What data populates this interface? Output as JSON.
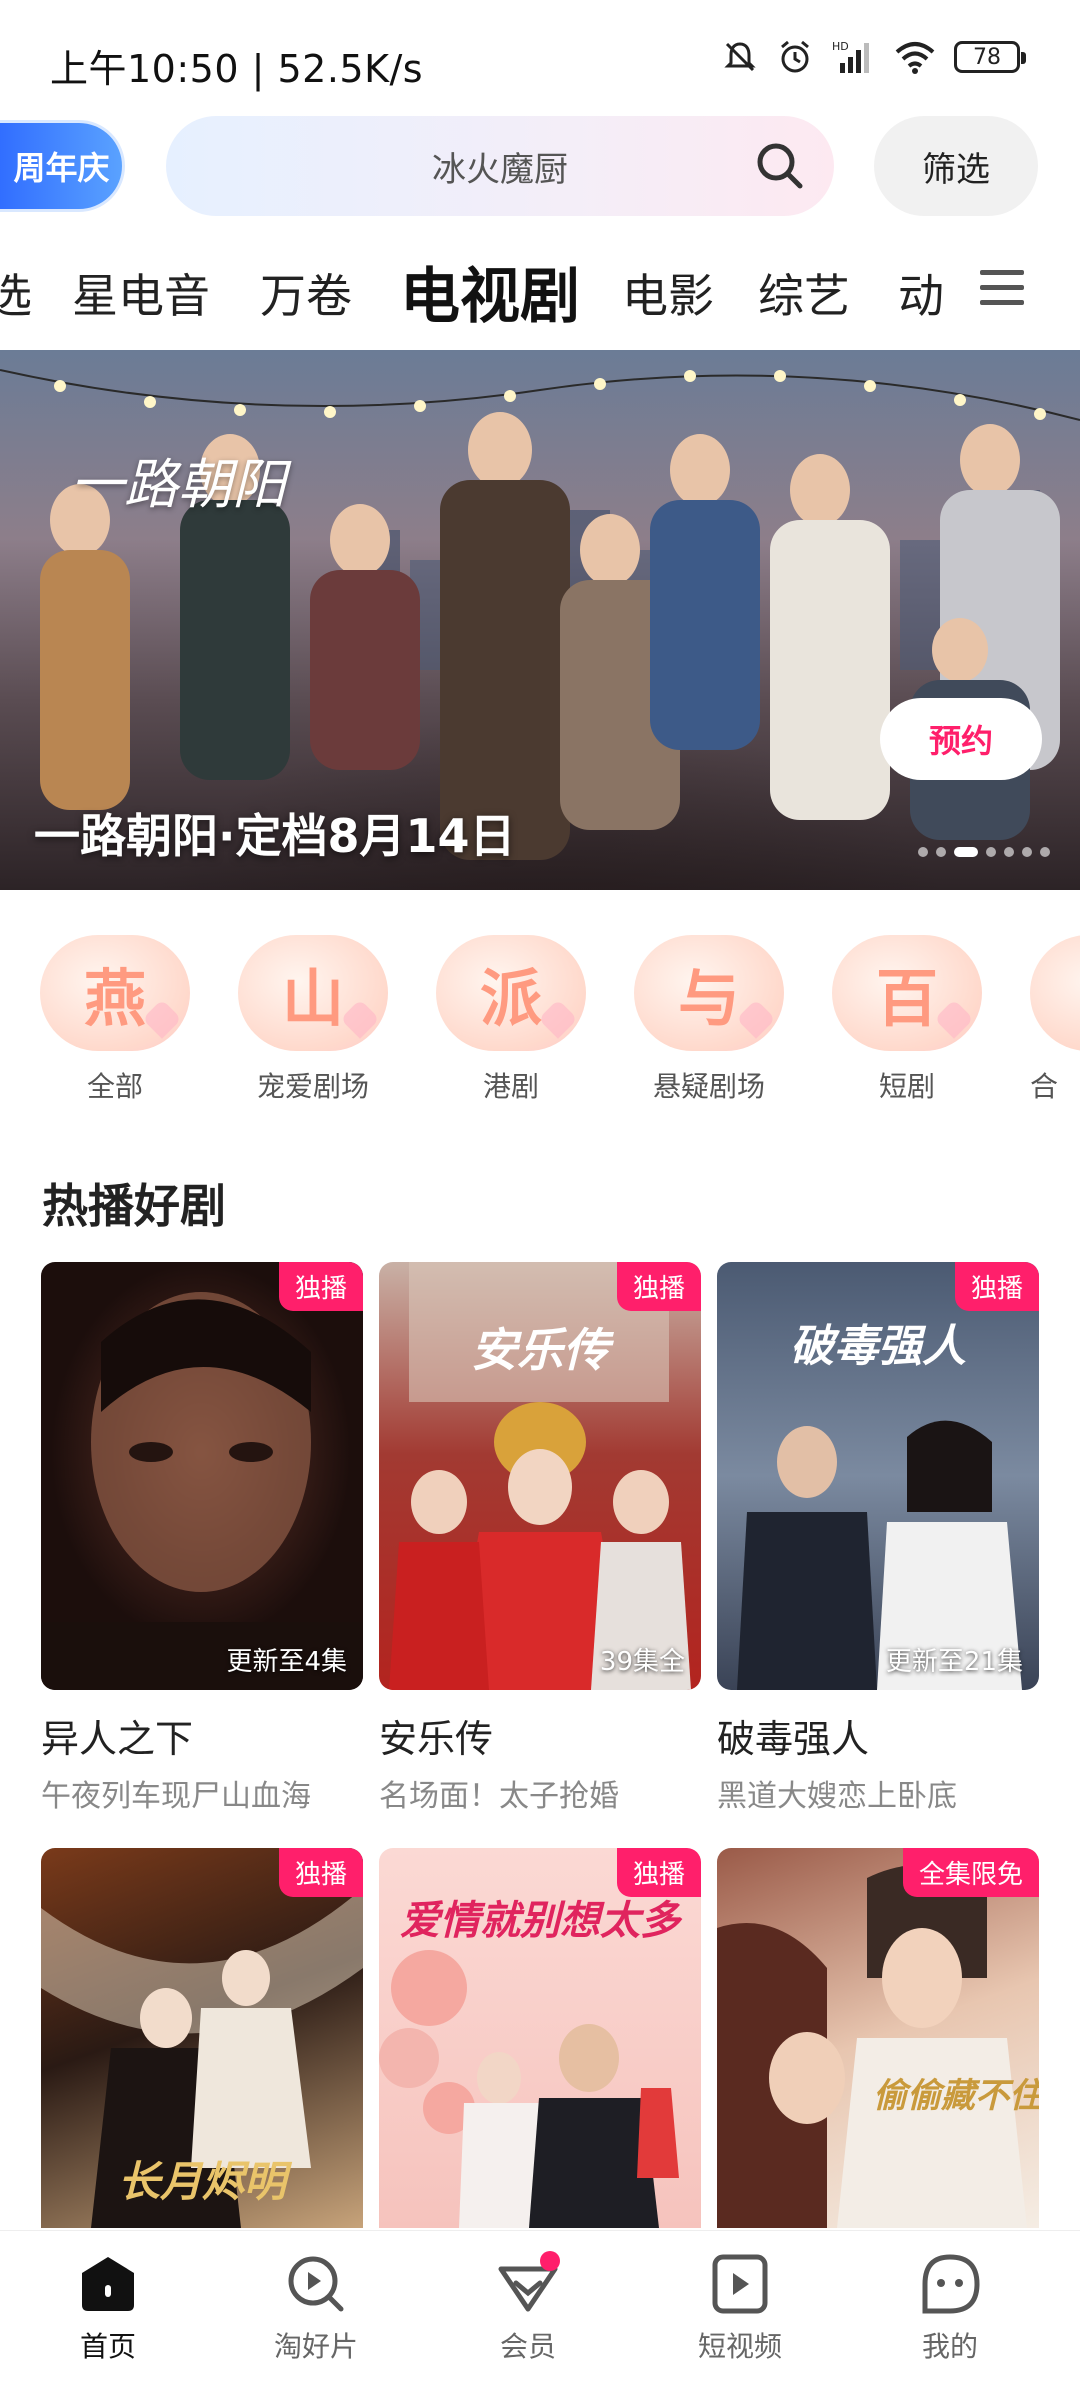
{
  "status_bar": {
    "time": "上午10:50 | 52.5K/s",
    "battery": "78"
  },
  "search": {
    "anniversary_label": "周年庆",
    "placeholder": "冰火魔厨",
    "filter_label": "筛选"
  },
  "tabs": [
    "选",
    "星电音",
    "万卷",
    "电视剧",
    "电影",
    "综艺",
    "动"
  ],
  "active_tab": "电视剧",
  "banner": {
    "title": "一路朝阳·定档8月14日",
    "logo_text": "一路朝阳",
    "reserve_label": "预约",
    "dot_count": 7,
    "active_dot": 2
  },
  "categories": [
    {
      "glyph": "燕",
      "label": "全部"
    },
    {
      "glyph": "山",
      "label": "宠爱剧场"
    },
    {
      "glyph": "派",
      "label": "港剧"
    },
    {
      "glyph": "与",
      "label": "悬疑剧场"
    },
    {
      "glyph": "百",
      "label": "短剧"
    },
    {
      "glyph": "",
      "label": "合"
    }
  ],
  "section": {
    "title": "热播好剧"
  },
  "dramas": [
    {
      "title": "异人之下",
      "subtitle": "午夜列车现尸山血海",
      "badge": "独播",
      "episodes": "更新至4集"
    },
    {
      "title": "安乐传",
      "subtitle": "名场面！太子抢婚",
      "badge": "独播",
      "episodes": "39集全",
      "poster_text": "安乐传"
    },
    {
      "title": "破毒强人",
      "subtitle": "黑道大嫂恋上卧底",
      "badge": "独播",
      "episodes": "更新至21集",
      "poster_text": "破毒强人"
    },
    {
      "badge": "独播",
      "poster_text": "长月烬明"
    },
    {
      "badge": "独播",
      "poster_text": "爱情就别想太多"
    },
    {
      "badge": "全集限免",
      "poster_text": "偷偷藏不住"
    }
  ],
  "bottom_nav": [
    {
      "label": "首页",
      "icon": "home-icon"
    },
    {
      "label": "淘好片",
      "icon": "discover-icon"
    },
    {
      "label": "会员",
      "icon": "vip-icon"
    },
    {
      "label": "短视频",
      "icon": "short-video-icon"
    },
    {
      "label": "我的",
      "icon": "profile-icon"
    }
  ],
  "colors": {
    "accent": "#ff1f6b",
    "anniversary": "#2f6bff"
  }
}
